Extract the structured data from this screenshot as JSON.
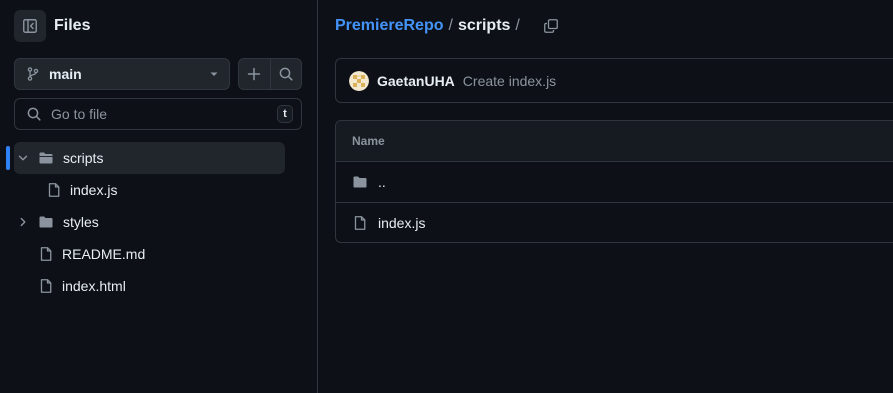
{
  "sidebar": {
    "title": "Files",
    "branch": "main",
    "goto_placeholder": "Go to file",
    "goto_shortcut": "t",
    "tree": [
      {
        "label": "scripts",
        "type": "folder",
        "expanded": true,
        "active": true
      },
      {
        "label": "index.js",
        "type": "file"
      },
      {
        "label": "styles",
        "type": "folder",
        "expanded": false
      },
      {
        "label": "README.md",
        "type": "file"
      },
      {
        "label": "index.html",
        "type": "file"
      }
    ]
  },
  "breadcrumb": {
    "repo": "PremiereRepo",
    "separator": "/",
    "current": "scripts",
    "trailing": "/"
  },
  "commit": {
    "author": "GaetanUHA",
    "message": "Create index.js"
  },
  "table": {
    "header": "Name",
    "rows": [
      {
        "label": "..",
        "type": "folder"
      },
      {
        "label": "index.js",
        "type": "file"
      }
    ]
  },
  "colors": {
    "background": "#0d1117",
    "accent": "#2f81f7",
    "link": "#4493f8",
    "border": "#30363d",
    "muted": "#8b949e"
  }
}
